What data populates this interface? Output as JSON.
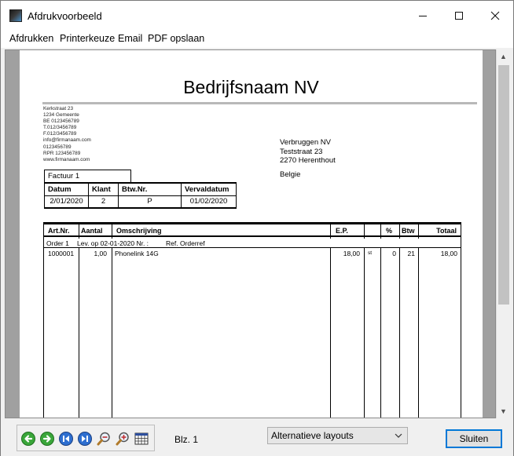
{
  "window": {
    "title": "Afdrukvoorbeeld"
  },
  "menu": [
    "Afdrukken",
    "Printerkeuze",
    "Email",
    "PDF opslaan"
  ],
  "invoice": {
    "company_name": "Bedrijfsnaam NV",
    "sender_lines": [
      "Kerkstraat 23",
      "1234 Gemeente",
      "BE 0123456789",
      "T.012/3456789",
      "F.012/3456789",
      "info@firmanaam.com",
      "0123456789",
      "RPR 123456789",
      "www.firmanaam.com"
    ],
    "recipient": {
      "name": "Verbruggen NV",
      "street": "Teststraat 23",
      "city": "2270 Herenthout",
      "country": "Belgie"
    },
    "factuur_label": "Factuur 1",
    "info_headers": [
      "Datum",
      "Klant",
      "Btw.Nr.",
      "Vervaldatum"
    ],
    "info_values": [
      "2/01/2020",
      "2",
      "P",
      "01/02/2020"
    ],
    "item_headers": {
      "artnr": "Art.Nr.",
      "aantal": "Aantal",
      "omschrijving": "Omschrijving",
      "ep": "E.P.",
      "unit": "",
      "pct": "%",
      "btw": "Btw",
      "totaal": "Totaal"
    },
    "order_line": {
      "order": "Order 1",
      "lev": "Lev. op 02-01-2020 Nr. :",
      "ref": "Ref. Orderref"
    },
    "items": [
      {
        "artnr": "1000001",
        "aantal": "1,00",
        "omschrijving": "Phonelink 14G",
        "ep": "18,00",
        "unit": "st",
        "pct": "0",
        "btw": "21",
        "totaal": "18,00"
      }
    ]
  },
  "status": {
    "page_label": "Blz. 1",
    "layout_select": "Alternatieve layouts",
    "close_label": "Sluiten"
  },
  "colors": {
    "nav_green": "#3aa63a",
    "nav_blue": "#2e6fd0",
    "focus_blue": "#0078d7"
  }
}
